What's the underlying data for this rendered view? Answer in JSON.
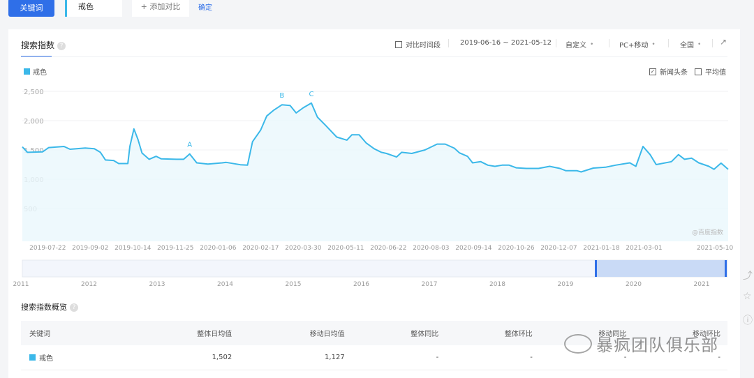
{
  "top": {
    "keyword_button": "关键词",
    "keyword_value": "戒色",
    "add_compare": "+ 添加对比",
    "confirm": "确定"
  },
  "card": {
    "title": "搜索指数",
    "help": "?",
    "compare_period": "对比时间段",
    "date_range": "2019-06-16 ~ 2021-05-12",
    "period_select": "自定义",
    "device_select": "PC+移动",
    "region_select": "全国",
    "news_headline": "新闻头条",
    "average": "平均值",
    "legend": "戒色",
    "watermark": "@百度指数"
  },
  "chart_data": {
    "type": "area",
    "series_name": "戒色",
    "start_date": "2019-06-16",
    "end_date": "2021-05-12",
    "x_unit": "days since 2019-06-16",
    "y_ticks": [
      "2,500",
      "2,000",
      "1,500",
      "1,000",
      "500"
    ],
    "y_tick_values": [
      2500,
      2000,
      1500,
      1000,
      500
    ],
    "ylim": [
      0,
      2500
    ],
    "x_ticks": [
      "2019-07-22",
      "2019-09-02",
      "2019-10-14",
      "2019-11-25",
      "2020-01-06",
      "2020-02-17",
      "2020-03-30",
      "2020-05-11",
      "2020-06-22",
      "2020-08-03",
      "2020-09-14",
      "2020-10-26",
      "2020-12-07",
      "2021-01-18",
      "2021-03-01",
      "2021-05-10"
    ],
    "x_tick_days": [
      36,
      78,
      120,
      162,
      204,
      246,
      288,
      330,
      372,
      414,
      456,
      498,
      540,
      582,
      624,
      694
    ],
    "points": [
      [
        0,
        1552
      ],
      [
        5,
        1460
      ],
      [
        20,
        1468
      ],
      [
        26,
        1540
      ],
      [
        41,
        1560
      ],
      [
        47,
        1512
      ],
      [
        62,
        1532
      ],
      [
        71,
        1520
      ],
      [
        77,
        1460
      ],
      [
        82,
        1328
      ],
      [
        90,
        1320
      ],
      [
        95,
        1268
      ],
      [
        104,
        1268
      ],
      [
        106,
        1560
      ],
      [
        110,
        1860
      ],
      [
        114,
        1680
      ],
      [
        118,
        1448
      ],
      [
        125,
        1340
      ],
      [
        132,
        1392
      ],
      [
        137,
        1348
      ],
      [
        152,
        1340
      ],
      [
        159,
        1340
      ],
      [
        165,
        1432
      ],
      [
        172,
        1280
      ],
      [
        183,
        1260
      ],
      [
        197,
        1280
      ],
      [
        201,
        1288
      ],
      [
        215,
        1248
      ],
      [
        222,
        1240
      ],
      [
        227,
        1640
      ],
      [
        235,
        1840
      ],
      [
        241,
        2080
      ],
      [
        248,
        2180
      ],
      [
        256,
        2272
      ],
      [
        264,
        2260
      ],
      [
        270,
        2132
      ],
      [
        277,
        2220
      ],
      [
        285,
        2300
      ],
      [
        291,
        2060
      ],
      [
        299,
        1920
      ],
      [
        310,
        1720
      ],
      [
        320,
        1668
      ],
      [
        325,
        1760
      ],
      [
        332,
        1760
      ],
      [
        339,
        1620
      ],
      [
        347,
        1520
      ],
      [
        354,
        1460
      ],
      [
        359,
        1440
      ],
      [
        369,
        1380
      ],
      [
        374,
        1460
      ],
      [
        384,
        1440
      ],
      [
        397,
        1500
      ],
      [
        409,
        1600
      ],
      [
        417,
        1600
      ],
      [
        426,
        1530
      ],
      [
        431,
        1450
      ],
      [
        439,
        1390
      ],
      [
        444,
        1280
      ],
      [
        452,
        1300
      ],
      [
        459,
        1240
      ],
      [
        466,
        1220
      ],
      [
        473,
        1240
      ],
      [
        480,
        1240
      ],
      [
        487,
        1195
      ],
      [
        497,
        1185
      ],
      [
        509,
        1185
      ],
      [
        520,
        1220
      ],
      [
        530,
        1185
      ],
      [
        536,
        1145
      ],
      [
        547,
        1145
      ],
      [
        551,
        1125
      ],
      [
        563,
        1190
      ],
      [
        575,
        1205
      ],
      [
        585,
        1240
      ],
      [
        599,
        1280
      ],
      [
        605,
        1220
      ],
      [
        612,
        1560
      ],
      [
        619,
        1420
      ],
      [
        625,
        1250
      ],
      [
        640,
        1300
      ],
      [
        647,
        1420
      ],
      [
        653,
        1340
      ],
      [
        660,
        1360
      ],
      [
        667,
        1280
      ],
      [
        677,
        1220
      ],
      [
        682,
        1170
      ],
      [
        689,
        1275
      ],
      [
        696,
        1170
      ]
    ],
    "annotations": [
      {
        "label": "A",
        "day": 165,
        "value": 1432
      },
      {
        "label": "B",
        "day": 256,
        "value": 2272
      },
      {
        "label": "C",
        "day": 285,
        "value": 2300
      }
    ],
    "navigator": {
      "years": [
        "2011",
        "2012",
        "2013",
        "2014",
        "2015",
        "2016",
        "2017",
        "2018",
        "2019",
        "2020",
        "2021"
      ],
      "selected_from": "2019-06-16",
      "selected_to": "2021-05-12"
    },
    "color": "#3bb8e9"
  },
  "overview": {
    "title": "搜索指数概览",
    "columns": [
      "关键词",
      "整体日均值",
      "移动日均值",
      "整体同比",
      "整体环比",
      "移动同比",
      "移动环比"
    ],
    "rows": [
      {
        "keyword": "戒色",
        "cells": [
          "1,502",
          "1,127",
          "-",
          "-",
          "-",
          "-"
        ]
      }
    ]
  },
  "overlay_watermark": "暴疯团队俱乐部"
}
